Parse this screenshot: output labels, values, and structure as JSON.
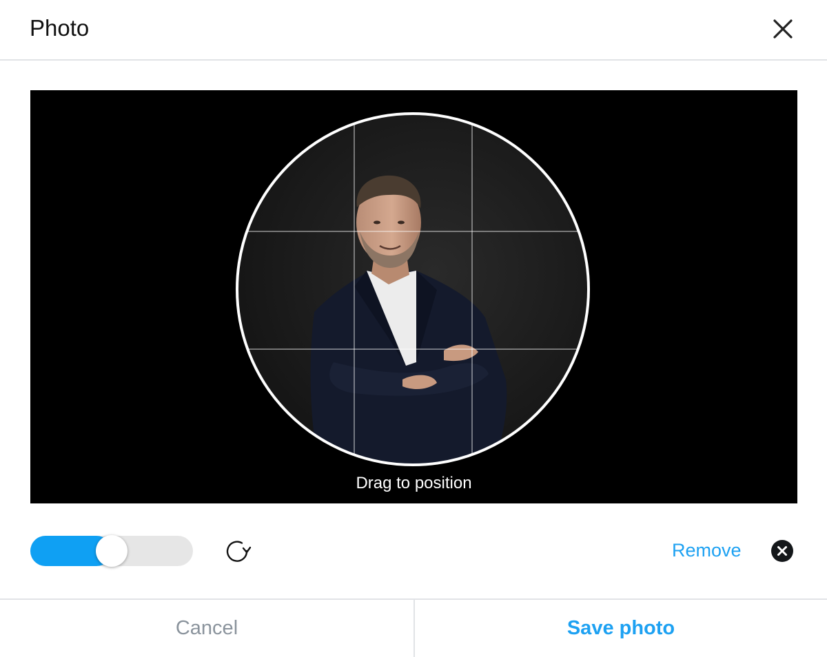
{
  "dialog": {
    "title": "Photo",
    "close_icon": "close-icon"
  },
  "editor": {
    "hint": "Drag to position",
    "background": "#000000",
    "crop_shape": "circle",
    "grid": "3x3",
    "photo_description_icon": "portrait-photo"
  },
  "controls": {
    "zoom_level": 0.5,
    "rotate_icon": "rotate-icon",
    "remove_label": "Remove",
    "remove_icon": "remove-circle-icon"
  },
  "footer": {
    "cancel_label": "Cancel",
    "save_label": "Save photo"
  },
  "colors": {
    "accent": "#1da1f2",
    "slider_fill": "#0fa0f3",
    "slider_track": "#e6e6e6",
    "muted": "#8a939c",
    "divider": "#e1e3e6"
  }
}
